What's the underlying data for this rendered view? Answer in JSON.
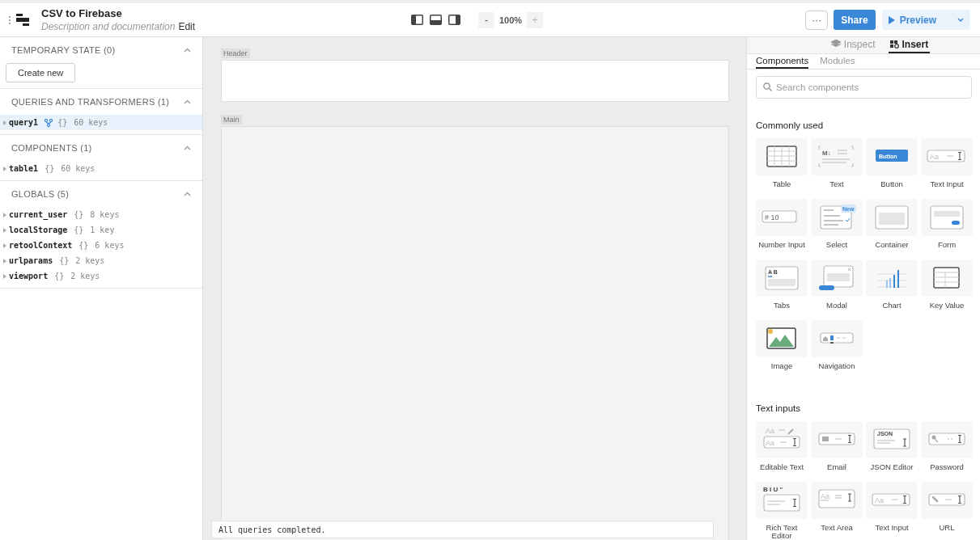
{
  "app": {
    "title": "CSV to Firebase",
    "description": "Description and documentation",
    "edit_link": "Edit"
  },
  "toolbar": {
    "zoom_out": "-",
    "zoom_level": "100%",
    "zoom_in": "+",
    "more": "···",
    "share": "Share",
    "preview": "Preview"
  },
  "state_panel": {
    "sections": [
      {
        "title": "TEMPORARY STATE (0)",
        "expanded": true,
        "button": "Create new"
      },
      {
        "title": "QUERIES AND TRANSFORMERS (1)",
        "expanded": true,
        "items": [
          {
            "name": "query1",
            "kind": "query",
            "braces": "{}",
            "count": "60 keys",
            "selected": true
          }
        ]
      },
      {
        "title": "COMPONENTS (1)",
        "expanded": true,
        "items": [
          {
            "name": "table1",
            "kind": "plain",
            "braces": "{}",
            "count": "60 keys",
            "selected": false
          }
        ]
      },
      {
        "title": "GLOBALS (5)",
        "expanded": true,
        "items": [
          {
            "name": "current_user",
            "kind": "plain",
            "braces": "{}",
            "count": "8 keys",
            "selected": false
          },
          {
            "name": "localStorage",
            "kind": "plain",
            "braces": "{}",
            "count": "1 key",
            "selected": false
          },
          {
            "name": "retoolContext",
            "kind": "plain",
            "braces": "{}",
            "count": "6 keys",
            "selected": false
          },
          {
            "name": "urlparams",
            "kind": "plain",
            "braces": "{}",
            "count": "2 keys",
            "selected": false
          },
          {
            "name": "viewport",
            "kind": "plain",
            "braces": "{}",
            "count": "2 keys",
            "selected": false
          }
        ]
      }
    ]
  },
  "canvas": {
    "frames": [
      {
        "label": "Header",
        "kind": "header"
      },
      {
        "label": "Main",
        "kind": "main"
      }
    ],
    "status_bar": "All queries completed."
  },
  "insert_panel": {
    "tabs": [
      {
        "label": "Inspect",
        "kind": "layers",
        "selected": false
      },
      {
        "label": "Insert",
        "kind": "blocks",
        "selected": true
      }
    ],
    "subtabs": [
      {
        "label": "Components",
        "selected": true
      },
      {
        "label": "Modules",
        "selected": false
      }
    ],
    "search": {
      "placeholder": "Search components"
    },
    "groups": [
      {
        "title": "Commonly used",
        "items": [
          {
            "label": "Table",
            "kind": "table"
          },
          {
            "label": "Text",
            "kind": "markdown",
            "sample": "M↓"
          },
          {
            "label": "Button",
            "kind": "button",
            "button_text": "Button"
          },
          {
            "label": "Text Input",
            "kind": "textinput",
            "sample": "Aa"
          },
          {
            "label": "Number Input",
            "kind": "number",
            "sample": "# 10"
          },
          {
            "label": "Select",
            "kind": "select",
            "badge": "New"
          },
          {
            "label": "Container",
            "kind": "container"
          },
          {
            "label": "Form",
            "kind": "form"
          },
          {
            "label": "Tabs",
            "kind": "tabs",
            "sample": "A B"
          },
          {
            "label": "Modal",
            "kind": "modal"
          },
          {
            "label": "Chart",
            "kind": "chart"
          },
          {
            "label": "Key Value",
            "kind": "keyvalue"
          },
          {
            "label": "Image",
            "kind": "image"
          },
          {
            "label": "Navigation",
            "kind": "navigation"
          }
        ]
      },
      {
        "title": "Text inputs",
        "items": [
          {
            "label": "Editable Text",
            "kind": "editable",
            "sample": "Aa",
            "sample2": "Aa"
          },
          {
            "label": "Email",
            "kind": "email"
          },
          {
            "label": "JSON Editor",
            "kind": "json",
            "sample": "JSON"
          },
          {
            "label": "Password",
            "kind": "password"
          },
          {
            "label": "Rich Text Editor",
            "kind": "richtext",
            "sample": "B I U \""
          },
          {
            "label": "Text Area",
            "kind": "textarea",
            "sample": "Aa"
          },
          {
            "label": "Text Input",
            "kind": "textinput",
            "sample": "Aa"
          },
          {
            "label": "URL",
            "kind": "url"
          }
        ]
      }
    ]
  }
}
